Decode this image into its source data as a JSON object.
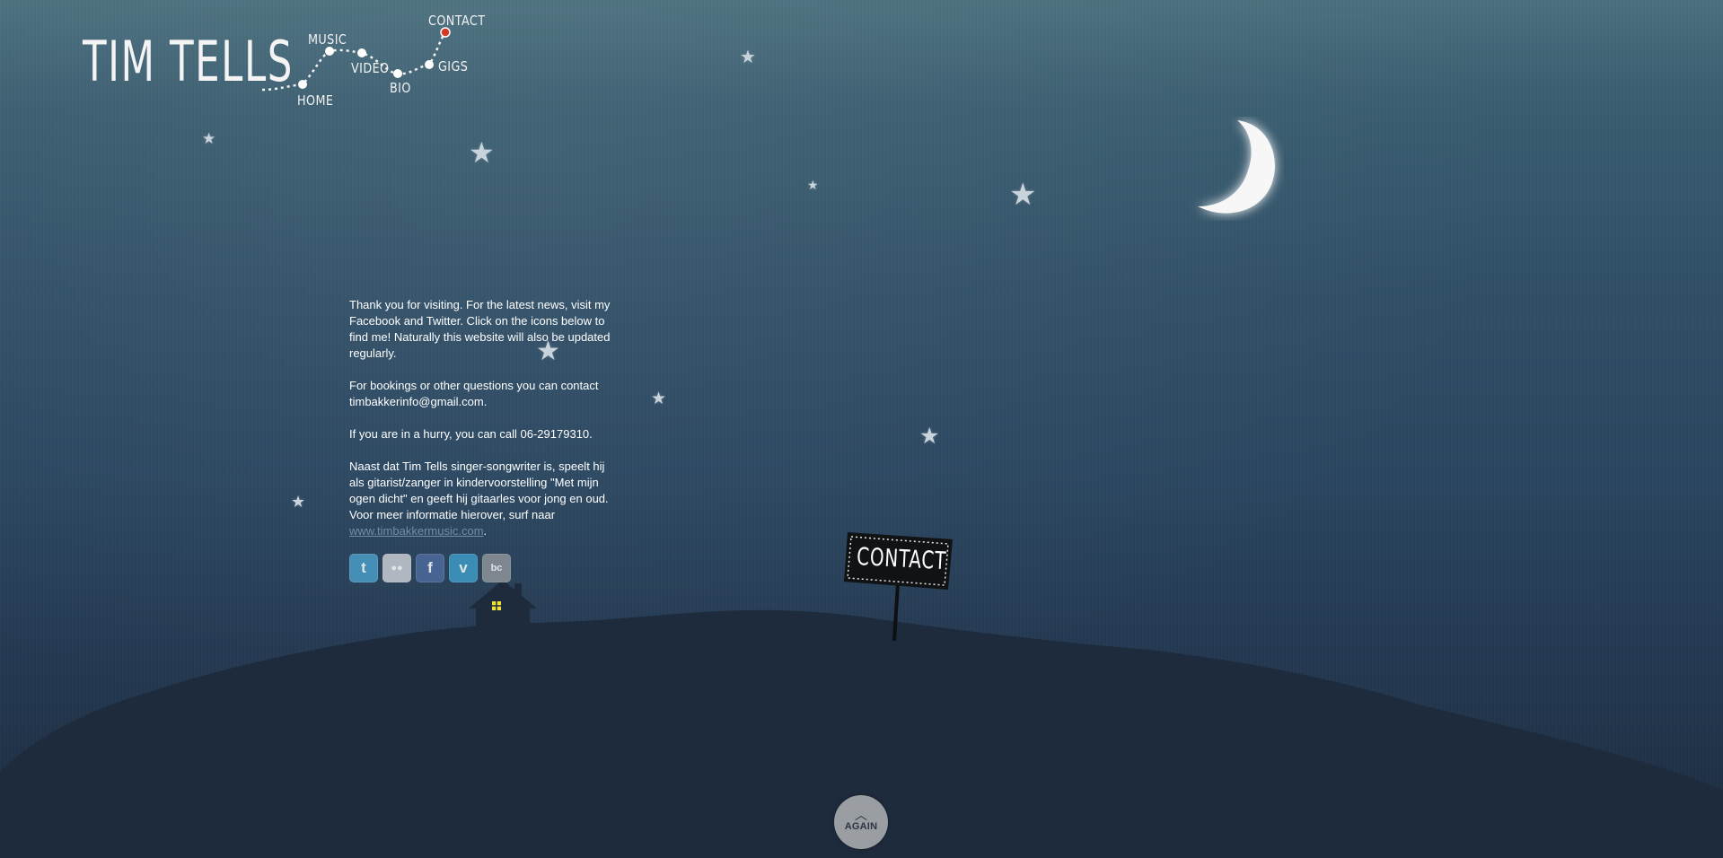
{
  "site": {
    "logo": "TIM TELLS"
  },
  "nav": {
    "home": "HOME",
    "music": "MUSIC",
    "video": "VIDEO",
    "bio": "BIO",
    "gigs": "GIGS",
    "contact": "CONTACT"
  },
  "content": {
    "paragraph1": "Thank you for visiting. For the latest news, visit my Facebook and Twitter. Click on the icons below to find me! Naturally this website will also be updated regularly.",
    "paragraph2": "For bookings or other questions you can contact timbakkerinfo@gmail.com.",
    "paragraph3": "If you are in a hurry, you can call 06-29179310.",
    "paragraph4_text": "Naast dat Tim Tells singer-songwriter is, speelt hij als gitarist/zanger in kindervoorstelling \"Met mijn ogen dicht\" en geeft hij gitaarles voor jong en oud. Voor meer informatie hierover, surf naar ",
    "paragraph4_link": "www.timbakkermusic.com",
    "paragraph4_end": "."
  },
  "social": [
    {
      "name": "twitter-icon",
      "glyph": "t",
      "color": "#4a9cc7"
    },
    {
      "name": "flickr-icon",
      "glyph": "●●",
      "color": "#c8ccd2"
    },
    {
      "name": "facebook-icon",
      "glyph": "f",
      "color": "#4d6a9c"
    },
    {
      "name": "vimeo-icon",
      "glyph": "v",
      "color": "#3d9ac4"
    },
    {
      "name": "bandcamp-icon",
      "glyph": "bc",
      "color": "#8d9398"
    }
  ],
  "scene": {
    "sign_text": "CONTACT",
    "again_label": "AGAIN"
  },
  "colors": {
    "accent_dot": "#d23a2a",
    "window_light": "#f1e23a",
    "hill": "#1d2b3c"
  }
}
